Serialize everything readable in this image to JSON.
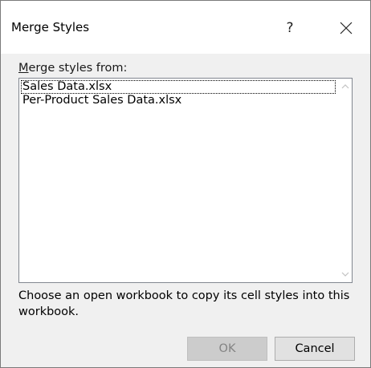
{
  "window": {
    "title": "Merge Styles",
    "help_label": "?",
    "close_icon": "close-icon"
  },
  "merge_list": {
    "label_accesskey": "M",
    "label_rest": "erge styles from:",
    "items": [
      {
        "label": "Sales Data.xlsx",
        "focused": true
      },
      {
        "label": "Per-Product Sales Data.xlsx",
        "focused": false
      }
    ],
    "scrollbar": {
      "up_icon": "chevron-up-icon",
      "down_icon": "chevron-down-icon"
    }
  },
  "description": "Choose an open workbook to copy its cell styles into this workbook.",
  "buttons": {
    "ok_label": "OK",
    "ok_enabled": false,
    "cancel_label": "Cancel"
  },
  "colors": {
    "dialog_background": "#f0f0f0",
    "titlebar_background": "#ffffff",
    "disabled_button_text": "#838383"
  }
}
